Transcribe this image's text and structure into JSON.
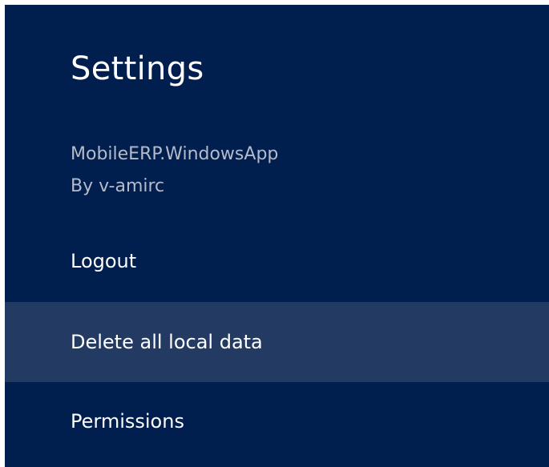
{
  "charm": {
    "title": "Settings",
    "app_name": "MobileERP.WindowsApp",
    "publisher": "By v-amirc"
  },
  "menu": {
    "items": [
      {
        "label": "Logout"
      },
      {
        "label": "Delete all local data",
        "highlighted": true
      },
      {
        "label": "Permissions"
      }
    ]
  },
  "colors": {
    "panel_background": "#001e4e",
    "highlight_background": "#233b62",
    "secondary_text": "#b4bccb",
    "primary_text": "#ffffff"
  }
}
